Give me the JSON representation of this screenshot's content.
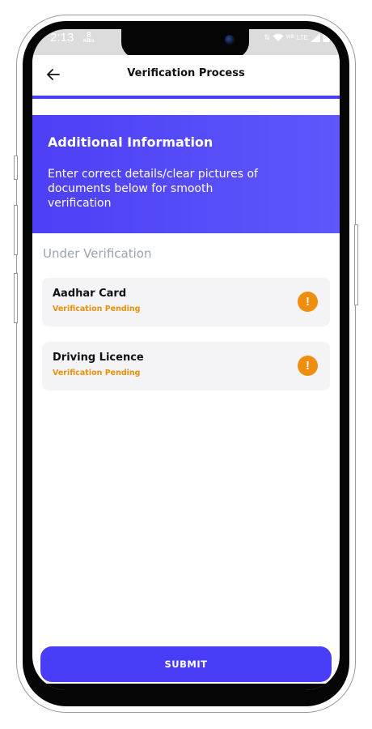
{
  "status_bar": {
    "time": "2:13",
    "speed_value": "8",
    "speed_unit": "KB/s",
    "network": "LTE",
    "wifi_label": "Wifi"
  },
  "header": {
    "title": "Verification Process",
    "progress": 1.0
  },
  "banner": {
    "title": "Additional Information",
    "text": "Enter correct details/clear pictures of documents below for smooth verification"
  },
  "section": {
    "label": "Under Verification"
  },
  "documents": [
    {
      "name": "Aadhar Card",
      "status": "Verification Pending",
      "icon": "warning-icon",
      "icon_glyph": "!"
    },
    {
      "name": "Driving Licence",
      "status": "Verification Pending",
      "icon": "warning-icon",
      "icon_glyph": "!"
    }
  ],
  "submit": {
    "label": "SUBMIT"
  },
  "colors": {
    "accent": "#4a3df7",
    "warning": "#ef8e0c",
    "muted_label": "#9aa3b2",
    "card_bg": "#f4f4f6"
  }
}
